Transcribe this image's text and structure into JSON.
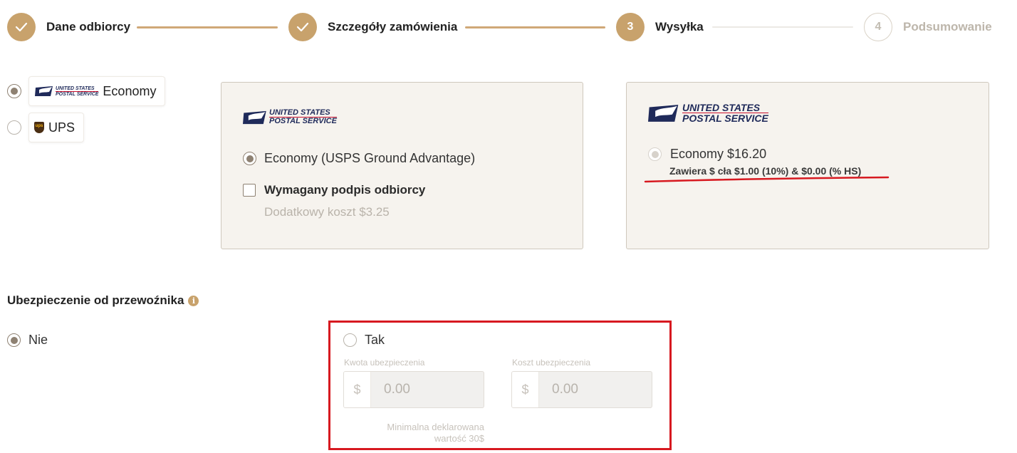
{
  "stepper": {
    "steps": [
      {
        "number": "✓",
        "label": "Dane odbiorcy",
        "state": "done"
      },
      {
        "number": "✓",
        "label": "Szczegóły zamówienia",
        "state": "done"
      },
      {
        "number": "3",
        "label": "Wysyłka",
        "state": "active"
      },
      {
        "number": "4",
        "label": "Podsumowanie",
        "state": "todo"
      }
    ]
  },
  "carriers": [
    {
      "label": "Economy",
      "logo_line1": "UNITED STATES",
      "logo_line2": "POSTAL SERVICE",
      "selected": true
    },
    {
      "label": "UPS",
      "logo_text": "ups",
      "selected": false
    }
  ],
  "option_card": {
    "logo_line1": "UNITED STATES",
    "logo_line2": "POSTAL SERVICE",
    "service_label": "Economy (USPS Ground Advantage)",
    "signature_label": "Wymagany podpis odbiorcy",
    "signature_cost": "Dodatkowy koszt $3.25"
  },
  "price_card": {
    "logo_line1": "UNITED STATES",
    "logo_line2": "POSTAL SERVICE",
    "price_label": "Economy $16.20",
    "duty_note": "Zawiera $ cła $1.00 (10%) & $0.00 (% HS)"
  },
  "insurance": {
    "title": "Ubezpieczenie od przewoźnika",
    "info_glyph": "i",
    "no_label": "Nie",
    "yes_label": "Tak",
    "amount_label": "Kwota ubezpieczenia",
    "amount_prefix": "$",
    "amount_value": "0.00",
    "cost_label": "Koszt ubezpieczenia",
    "cost_prefix": "$",
    "cost_value": "0.00",
    "min_hint_line1": "Minimalna deklarowana",
    "min_hint_line2": "wartość 30$"
  },
  "colors": {
    "accent": "#c8a26c",
    "card_bg": "#f6f3ee",
    "highlight_red": "#d71920",
    "usps_blue": "#1f2a5a"
  }
}
